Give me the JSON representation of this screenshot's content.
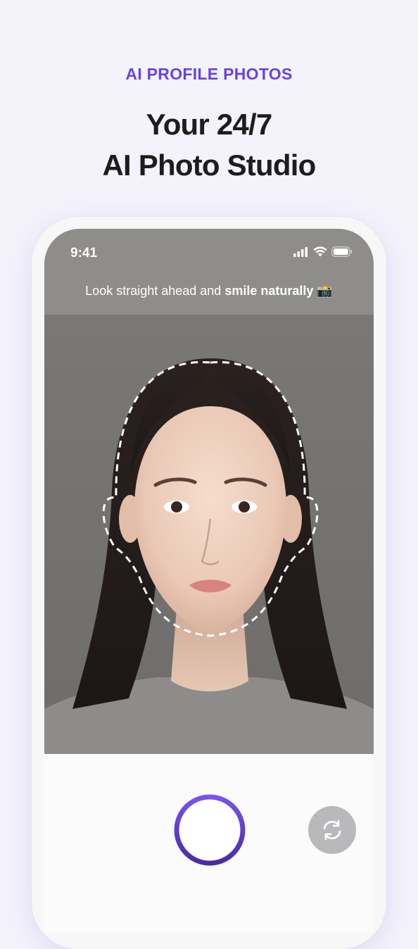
{
  "header": {
    "eyebrow": "AI PROFILE PHOTOS",
    "headline_line1": "Your 24/7",
    "headline_line2": "AI Photo Studio"
  },
  "phone": {
    "status_bar": {
      "time": "9:41",
      "icons": [
        "cellular-signal-icon",
        "wifi-icon",
        "battery-icon"
      ]
    },
    "instruction": {
      "prefix": "Look straight ahead and ",
      "emphasis": "smile naturally",
      "emoji": "📸"
    },
    "camera": {
      "guide_icon": "face-outline-guide-icon",
      "subject": "portrait-photo"
    },
    "controls": {
      "shutter_icon": "shutter-button-icon",
      "flip_icon": "switch-camera-icon"
    }
  },
  "colors": {
    "accent": "#6a42e0",
    "accent_dark": "#4a2aa8",
    "background": "#f4f3fb",
    "camera_bg": "#7a7876",
    "top_bar": "#8f8d89",
    "flip_button": "#b9b9bb"
  }
}
